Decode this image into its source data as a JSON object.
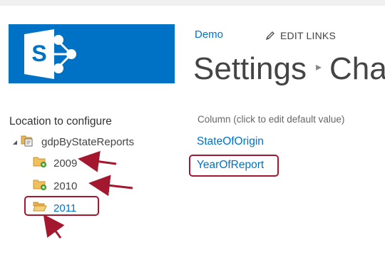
{
  "header": {
    "site_link": "Demo",
    "edit_links_label": "EDIT LINKS",
    "title_main": "Settings",
    "title_separator": "▸",
    "title_next": "Cha",
    "logo_icon": "sharepoint-logo-icon",
    "brand_color": "#0072c6"
  },
  "tree": {
    "label": "Location to configure",
    "root": {
      "label": "gdpByStateReports",
      "icon": "library-icon"
    },
    "children": [
      {
        "label": "2009",
        "icon": "folder-gear-icon"
      },
      {
        "label": "2010",
        "icon": "folder-gear-icon"
      },
      {
        "label": "2011",
        "icon": "folder-open-icon"
      }
    ]
  },
  "columns": {
    "header": "Column (click to edit default value)",
    "items": [
      {
        "label": "StateOfOrigin"
      },
      {
        "label": "YearOfReport"
      }
    ]
  },
  "annotations": {
    "highlight_color": "#a3182f",
    "arrow_color": "#a3182f"
  }
}
